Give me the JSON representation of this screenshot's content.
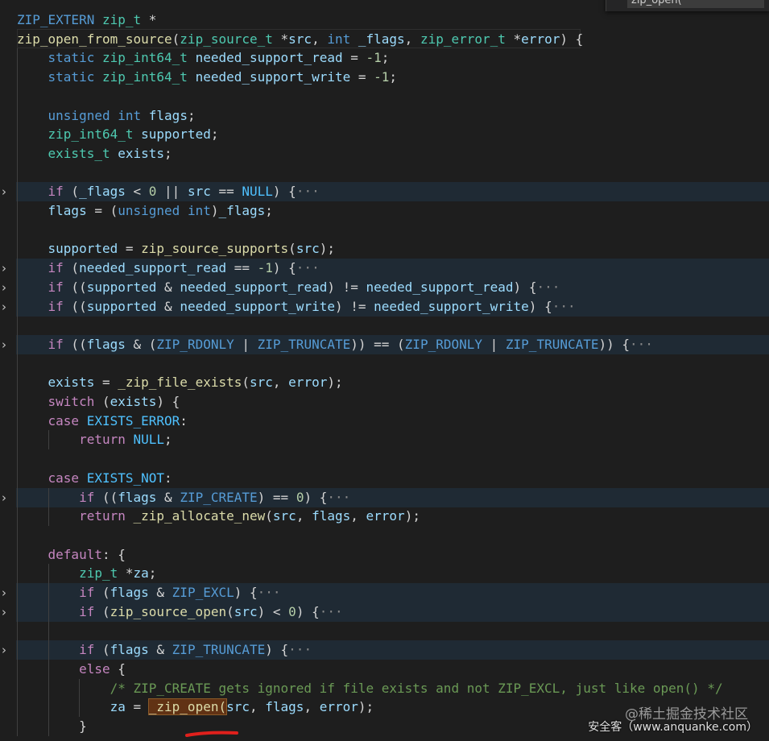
{
  "editor": {
    "find_widget": {
      "query": "zip_open("
    },
    "annotation": "red underline beneath _zip_open call",
    "lines": [
      {
        "id": "l01",
        "tokens": [
          [
            "ma",
            "ZIP_EXTERN"
          ],
          [
            "pl",
            " "
          ],
          [
            "ty",
            "zip_t"
          ],
          [
            "pl",
            " *"
          ]
        ]
      },
      {
        "id": "l02",
        "tokens": [
          [
            "fn",
            "zip_open_from_source"
          ],
          [
            "pl",
            "("
          ],
          [
            "ty",
            "zip_source_t"
          ],
          [
            "pl",
            " *"
          ],
          [
            "va",
            "src"
          ],
          [
            "pl",
            ", "
          ],
          [
            "kw",
            "int"
          ],
          [
            "pl",
            " "
          ],
          [
            "va",
            "_flags"
          ],
          [
            "pl",
            ", "
          ],
          [
            "ty",
            "zip_error_t"
          ],
          [
            "pl",
            " *"
          ],
          [
            "va",
            "error"
          ],
          [
            "pl",
            ") {"
          ]
        ]
      },
      {
        "id": "l03",
        "tokens": [
          [
            "pl",
            "    "
          ],
          [
            "kw",
            "static"
          ],
          [
            "pl",
            " "
          ],
          [
            "ty",
            "zip_int64_t"
          ],
          [
            "pl",
            " "
          ],
          [
            "va",
            "needed_support_read"
          ],
          [
            "pl",
            " = "
          ],
          [
            "nu",
            "-1"
          ],
          [
            "pl",
            ";"
          ]
        ]
      },
      {
        "id": "l04",
        "tokens": [
          [
            "pl",
            "    "
          ],
          [
            "kw",
            "static"
          ],
          [
            "pl",
            " "
          ],
          [
            "ty",
            "zip_int64_t"
          ],
          [
            "pl",
            " "
          ],
          [
            "va",
            "needed_support_write"
          ],
          [
            "pl",
            " = "
          ],
          [
            "nu",
            "-1"
          ],
          [
            "pl",
            ";"
          ]
        ]
      },
      {
        "id": "l05",
        "tokens": []
      },
      {
        "id": "l06",
        "tokens": [
          [
            "pl",
            "    "
          ],
          [
            "kw",
            "unsigned"
          ],
          [
            "pl",
            " "
          ],
          [
            "kw",
            "int"
          ],
          [
            "pl",
            " "
          ],
          [
            "va",
            "flags"
          ],
          [
            "pl",
            ";"
          ]
        ]
      },
      {
        "id": "l07",
        "tokens": [
          [
            "pl",
            "    "
          ],
          [
            "ty",
            "zip_int64_t"
          ],
          [
            "pl",
            " "
          ],
          [
            "va",
            "supported"
          ],
          [
            "pl",
            ";"
          ]
        ]
      },
      {
        "id": "l08",
        "tokens": [
          [
            "pl",
            "    "
          ],
          [
            "ty",
            "exists_t"
          ],
          [
            "pl",
            " "
          ],
          [
            "va",
            "exists"
          ],
          [
            "pl",
            ";"
          ]
        ]
      },
      {
        "id": "l09",
        "tokens": []
      },
      {
        "id": "l10",
        "folded": true,
        "tokens": [
          [
            "pl",
            "    "
          ],
          [
            "ctl",
            "if"
          ],
          [
            "pl",
            " ("
          ],
          [
            "va",
            "_flags"
          ],
          [
            "pl",
            " < "
          ],
          [
            "nu",
            "0"
          ],
          [
            "pl",
            " || "
          ],
          [
            "va",
            "src"
          ],
          [
            "pl",
            " == "
          ],
          [
            "co",
            "NULL"
          ],
          [
            "pl",
            ") {"
          ],
          [
            "dots",
            "···"
          ]
        ]
      },
      {
        "id": "l11",
        "tokens": [
          [
            "pl",
            "    "
          ],
          [
            "va",
            "flags"
          ],
          [
            "pl",
            " = ("
          ],
          [
            "kw",
            "unsigned"
          ],
          [
            "pl",
            " "
          ],
          [
            "kw",
            "int"
          ],
          [
            "pl",
            ")"
          ],
          [
            "va",
            "_flags"
          ],
          [
            "pl",
            ";"
          ]
        ]
      },
      {
        "id": "l12",
        "tokens": []
      },
      {
        "id": "l13",
        "tokens": [
          [
            "pl",
            "    "
          ],
          [
            "va",
            "supported"
          ],
          [
            "pl",
            " = "
          ],
          [
            "fn",
            "zip_source_supports"
          ],
          [
            "pl",
            "("
          ],
          [
            "va",
            "src"
          ],
          [
            "pl",
            ");"
          ]
        ]
      },
      {
        "id": "l14",
        "folded": true,
        "tokens": [
          [
            "pl",
            "    "
          ],
          [
            "ctl",
            "if"
          ],
          [
            "pl",
            " ("
          ],
          [
            "va",
            "needed_support_read"
          ],
          [
            "pl",
            " == "
          ],
          [
            "nu",
            "-1"
          ],
          [
            "pl",
            ") {"
          ],
          [
            "dots",
            "···"
          ]
        ]
      },
      {
        "id": "l15",
        "folded": true,
        "tokens": [
          [
            "pl",
            "    "
          ],
          [
            "ctl",
            "if"
          ],
          [
            "pl",
            " (("
          ],
          [
            "va",
            "supported"
          ],
          [
            "pl",
            " & "
          ],
          [
            "va",
            "needed_support_read"
          ],
          [
            "pl",
            ") != "
          ],
          [
            "va",
            "needed_support_read"
          ],
          [
            "pl",
            ") {"
          ],
          [
            "dots",
            "···"
          ]
        ]
      },
      {
        "id": "l16",
        "folded": true,
        "tokens": [
          [
            "pl",
            "    "
          ],
          [
            "ctl",
            "if"
          ],
          [
            "pl",
            " (("
          ],
          [
            "va",
            "supported"
          ],
          [
            "pl",
            " & "
          ],
          [
            "va",
            "needed_support_write"
          ],
          [
            "pl",
            ") != "
          ],
          [
            "va",
            "needed_support_write"
          ],
          [
            "pl",
            ") {"
          ],
          [
            "dots",
            "···"
          ]
        ]
      },
      {
        "id": "l17",
        "tokens": []
      },
      {
        "id": "l18",
        "folded": true,
        "tokens": [
          [
            "pl",
            "    "
          ],
          [
            "ctl",
            "if"
          ],
          [
            "pl",
            " (("
          ],
          [
            "va",
            "flags"
          ],
          [
            "pl",
            " & ("
          ],
          [
            "ma",
            "ZIP_RDONLY"
          ],
          [
            "pl",
            " | "
          ],
          [
            "ma",
            "ZIP_TRUNCATE"
          ],
          [
            "pl",
            ")) == ("
          ],
          [
            "ma",
            "ZIP_RDONLY"
          ],
          [
            "pl",
            " | "
          ],
          [
            "ma",
            "ZIP_TRUNCATE"
          ],
          [
            "pl",
            ")) {"
          ],
          [
            "dots",
            "···"
          ]
        ]
      },
      {
        "id": "l19",
        "tokens": []
      },
      {
        "id": "l20",
        "tokens": [
          [
            "pl",
            "    "
          ],
          [
            "va",
            "exists"
          ],
          [
            "pl",
            " = "
          ],
          [
            "fn",
            "_zip_file_exists"
          ],
          [
            "pl",
            "("
          ],
          [
            "va",
            "src"
          ],
          [
            "pl",
            ", "
          ],
          [
            "va",
            "error"
          ],
          [
            "pl",
            ");"
          ]
        ]
      },
      {
        "id": "l21",
        "tokens": [
          [
            "pl",
            "    "
          ],
          [
            "ctl",
            "switch"
          ],
          [
            "pl",
            " ("
          ],
          [
            "va",
            "exists"
          ],
          [
            "pl",
            ") {"
          ]
        ]
      },
      {
        "id": "l22",
        "tokens": [
          [
            "pl",
            "    "
          ],
          [
            "ctl",
            "case"
          ],
          [
            "pl",
            " "
          ],
          [
            "co",
            "EXISTS_ERROR"
          ],
          [
            "pl",
            ":"
          ]
        ]
      },
      {
        "id": "l23",
        "tokens": [
          [
            "pl",
            "        "
          ],
          [
            "ctl",
            "return"
          ],
          [
            "pl",
            " "
          ],
          [
            "co",
            "NULL"
          ],
          [
            "pl",
            ";"
          ]
        ]
      },
      {
        "id": "l24",
        "tokens": []
      },
      {
        "id": "l25",
        "tokens": [
          [
            "pl",
            "    "
          ],
          [
            "ctl",
            "case"
          ],
          [
            "pl",
            " "
          ],
          [
            "co",
            "EXISTS_NOT"
          ],
          [
            "pl",
            ":"
          ]
        ]
      },
      {
        "id": "l26",
        "folded": true,
        "tokens": [
          [
            "pl",
            "        "
          ],
          [
            "ctl",
            "if"
          ],
          [
            "pl",
            " (("
          ],
          [
            "va",
            "flags"
          ],
          [
            "pl",
            " & "
          ],
          [
            "ma",
            "ZIP_CREATE"
          ],
          [
            "pl",
            ") == "
          ],
          [
            "nu",
            "0"
          ],
          [
            "pl",
            ") {"
          ],
          [
            "dots",
            "···"
          ]
        ]
      },
      {
        "id": "l27",
        "tokens": [
          [
            "pl",
            "        "
          ],
          [
            "ctl",
            "return"
          ],
          [
            "pl",
            " "
          ],
          [
            "fn",
            "_zip_allocate_new"
          ],
          [
            "pl",
            "("
          ],
          [
            "va",
            "src"
          ],
          [
            "pl",
            ", "
          ],
          [
            "va",
            "flags"
          ],
          [
            "pl",
            ", "
          ],
          [
            "va",
            "error"
          ],
          [
            "pl",
            ");"
          ]
        ]
      },
      {
        "id": "l28",
        "tokens": []
      },
      {
        "id": "l29",
        "tokens": [
          [
            "pl",
            "    "
          ],
          [
            "ctl",
            "default"
          ],
          [
            "pl",
            ": {"
          ]
        ]
      },
      {
        "id": "l30",
        "tokens": [
          [
            "pl",
            "        "
          ],
          [
            "ty",
            "zip_t"
          ],
          [
            "pl",
            " *"
          ],
          [
            "va",
            "za"
          ],
          [
            "pl",
            ";"
          ]
        ]
      },
      {
        "id": "l31",
        "folded": true,
        "tokens": [
          [
            "pl",
            "        "
          ],
          [
            "ctl",
            "if"
          ],
          [
            "pl",
            " ("
          ],
          [
            "va",
            "flags"
          ],
          [
            "pl",
            " & "
          ],
          [
            "ma",
            "ZIP_EXCL"
          ],
          [
            "pl",
            ") {"
          ],
          [
            "dots",
            "···"
          ]
        ]
      },
      {
        "id": "l32",
        "folded": true,
        "tokens": [
          [
            "pl",
            "        "
          ],
          [
            "ctl",
            "if"
          ],
          [
            "pl",
            " ("
          ],
          [
            "fn",
            "zip_source_open"
          ],
          [
            "pl",
            "("
          ],
          [
            "va",
            "src"
          ],
          [
            "pl",
            ") < "
          ],
          [
            "nu",
            "0"
          ],
          [
            "pl",
            ") {"
          ],
          [
            "dots",
            "···"
          ]
        ]
      },
      {
        "id": "l33",
        "tokens": []
      },
      {
        "id": "l34",
        "folded": true,
        "tokens": [
          [
            "pl",
            "        "
          ],
          [
            "ctl",
            "if"
          ],
          [
            "pl",
            " ("
          ],
          [
            "va",
            "flags"
          ],
          [
            "pl",
            " & "
          ],
          [
            "ma",
            "ZIP_TRUNCATE"
          ],
          [
            "pl",
            ") {"
          ],
          [
            "dots",
            "···"
          ]
        ]
      },
      {
        "id": "l35",
        "tokens": [
          [
            "pl",
            "        "
          ],
          [
            "ctl",
            "else"
          ],
          [
            "pl",
            " {"
          ]
        ]
      },
      {
        "id": "l36",
        "tokens": [
          [
            "pl",
            "            "
          ],
          [
            "cm",
            "/* ZIP_CREATE gets ignored if file exists and not ZIP_EXCL, just like open() */"
          ]
        ]
      },
      {
        "id": "l37",
        "tokens": [
          [
            "pl",
            "            "
          ],
          [
            "va",
            "za"
          ],
          [
            "pl",
            " = "
          ],
          [
            "fn match",
            "_zip_open("
          ],
          [
            "va",
            "src"
          ],
          [
            "pl",
            ", "
          ],
          [
            "va",
            "flags"
          ],
          [
            "pl",
            ", "
          ],
          [
            "va",
            "error"
          ],
          [
            "pl",
            ");"
          ]
        ]
      },
      {
        "id": "l38",
        "tokens": [
          [
            "pl",
            "        }"
          ]
        ]
      }
    ]
  },
  "watermark": {
    "line1": "@稀土掘金技术社区",
    "line2": "安全客（www.anquanke.com）"
  }
}
